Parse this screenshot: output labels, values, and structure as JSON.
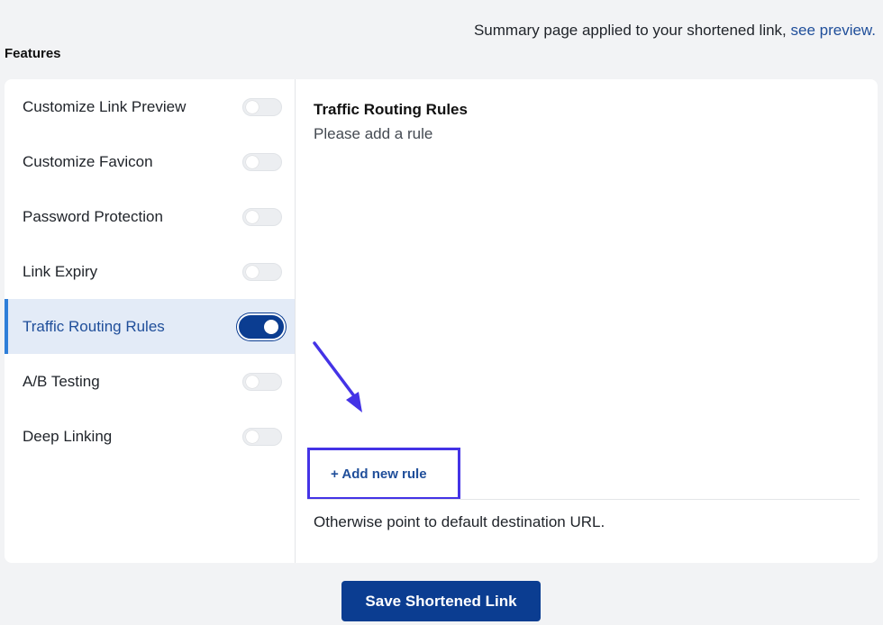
{
  "summary": {
    "text": "Summary page applied to your shortened link, ",
    "link": "see preview."
  },
  "features_heading": "Features",
  "sidebar": {
    "items": [
      {
        "label": "Customize Link Preview",
        "enabled": false
      },
      {
        "label": "Customize Favicon",
        "enabled": false
      },
      {
        "label": "Password Protection",
        "enabled": false
      },
      {
        "label": "Link Expiry",
        "enabled": false
      },
      {
        "label": "Traffic Routing Rules",
        "enabled": true,
        "active": true
      },
      {
        "label": "A/B Testing",
        "enabled": false
      },
      {
        "label": "Deep Linking",
        "enabled": false
      }
    ]
  },
  "content": {
    "title": "Traffic Routing Rules",
    "subtitle": "Please add a rule",
    "add_rule_label": "+ Add new rule",
    "fallback_text": "Otherwise point to default destination URL."
  },
  "save_button_label": "Save Shortened Link",
  "colors": {
    "accent": "#0b3d91",
    "link": "#1f4e9a",
    "active_bg": "#e3ebf7",
    "highlight": "#4433e6"
  }
}
